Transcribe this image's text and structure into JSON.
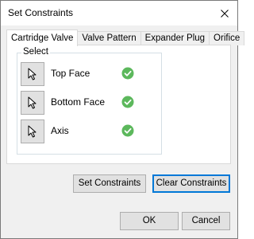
{
  "window": {
    "title": "Set Constraints"
  },
  "tabs": [
    {
      "label": "Cartridge Valve",
      "active": true
    },
    {
      "label": "Valve Pattern",
      "active": false
    },
    {
      "label": "Expander Plug",
      "active": false
    },
    {
      "label": "Orifice",
      "active": false
    }
  ],
  "select_group": {
    "label": "Select",
    "rows": [
      {
        "label": "Top Face",
        "icon": "cursor-arrow-icon",
        "status": "check-icon"
      },
      {
        "label": "Bottom Face",
        "icon": "cursor-arrow-icon",
        "status": "check-icon"
      },
      {
        "label": "Axis",
        "icon": "cursor-arrow-icon",
        "status": "check-icon"
      }
    ]
  },
  "buttons": {
    "set_constraints": "Set Constraints",
    "clear_constraints": "Clear Constraints",
    "ok": "OK",
    "cancel": "Cancel"
  },
  "colors": {
    "accent": "#0078d7",
    "check_green": "#5cb85c"
  }
}
